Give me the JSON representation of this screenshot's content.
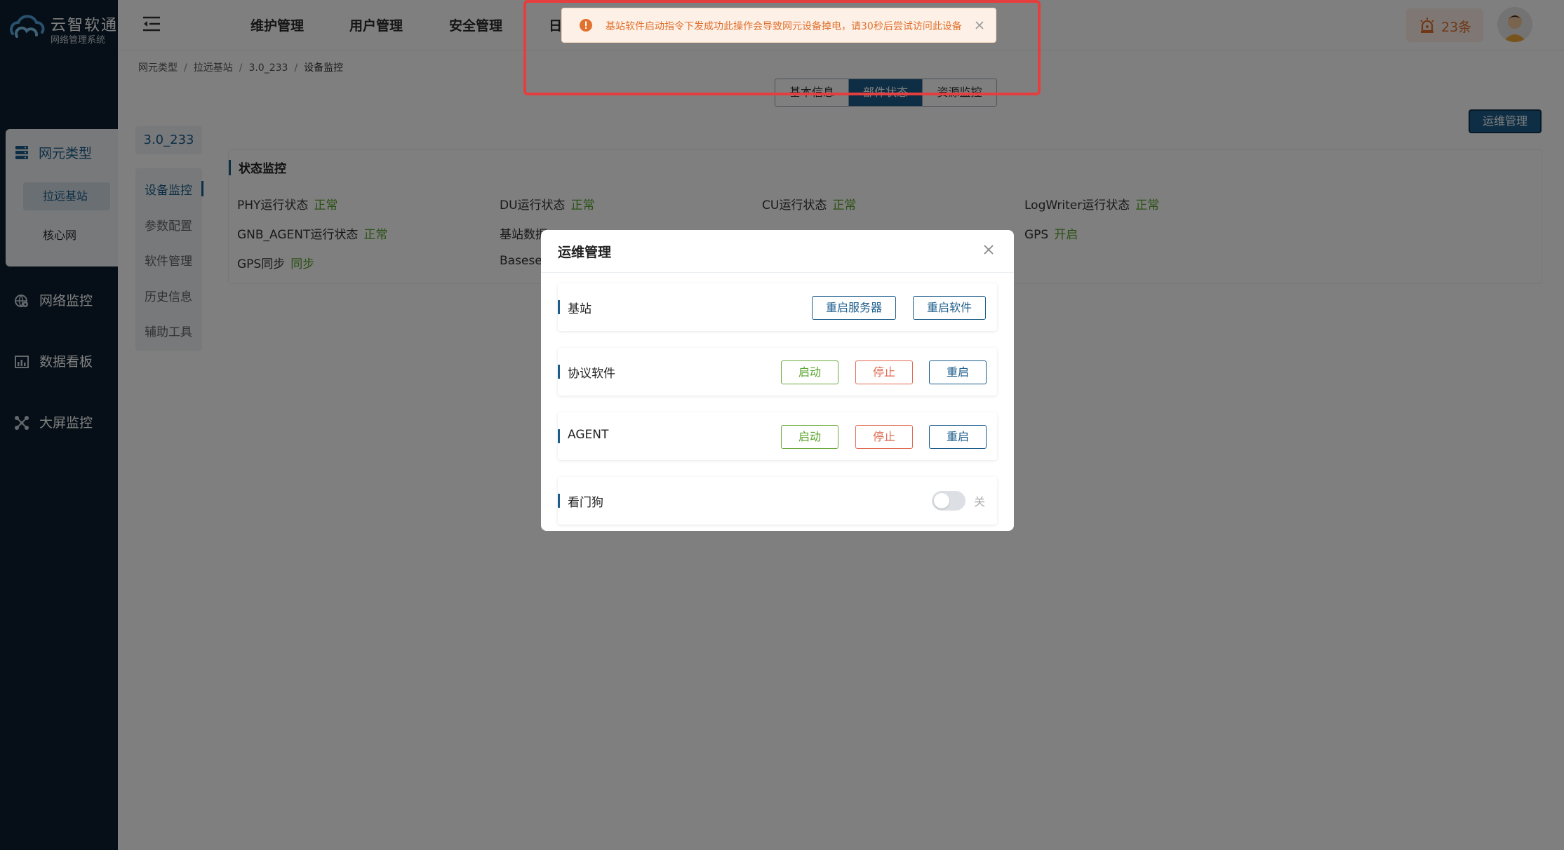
{
  "brand": {
    "title": "云智软通",
    "subtitle": "网络管理系统"
  },
  "sidebar": {
    "group": {
      "label": "网元类型",
      "items": [
        {
          "label": "拉远基站",
          "active": true
        },
        {
          "label": "核心网",
          "active": false
        }
      ]
    },
    "items": [
      {
        "label": "网络监控",
        "icon": "globe-gear-icon"
      },
      {
        "label": "数据看板",
        "icon": "bar-chart-icon"
      },
      {
        "label": "大屏监控",
        "icon": "network-icon"
      }
    ]
  },
  "header": {
    "nav": [
      "维护管理",
      "用户管理",
      "安全管理",
      "日"
    ],
    "alarm_count": "23条"
  },
  "breadcrumb": [
    "网元类型",
    "拉远基站",
    "3.0_233",
    "设备监控"
  ],
  "tabs": [
    {
      "label": "基本信息",
      "active": false
    },
    {
      "label": "部件状态",
      "active": true
    },
    {
      "label": "资源监控",
      "active": false
    }
  ],
  "ops_button": "运维管理",
  "device_name": "3.0_233",
  "side_menu": [
    {
      "label": "设备监控",
      "active": true
    },
    {
      "label": "参数配置",
      "active": false
    },
    {
      "label": "软件管理",
      "active": false
    },
    {
      "label": "历史信息",
      "active": false
    },
    {
      "label": "辅助工具",
      "active": false
    }
  ],
  "status_panel": {
    "title": "状态监控",
    "items": [
      {
        "label": "PHY运行状态",
        "value": "正常"
      },
      {
        "label": "DU运行状态",
        "value": "正常"
      },
      {
        "label": "CU运行状态",
        "value": "正常"
      },
      {
        "label": "LogWriter运行状态",
        "value": "正常"
      },
      {
        "label": "GNB_AGENT运行状态",
        "value": "正常"
      },
      {
        "label": "基站数据",
        "value": ""
      },
      {
        "label": "GPS",
        "value": "开启"
      },
      {
        "label": "GPS同步",
        "value": "同步"
      },
      {
        "label": "Basese",
        "value": ""
      }
    ]
  },
  "modal": {
    "title": "运维管理",
    "rows": [
      {
        "label": "基站",
        "buttons": [
          "重启服务器",
          "重启软件"
        ]
      },
      {
        "label": "协议软件",
        "buttons": [
          "启动",
          "停止",
          "重启"
        ]
      },
      {
        "label": "AGENT",
        "buttons": [
          "启动",
          "停止",
          "重启"
        ]
      },
      {
        "label": "看门狗",
        "toggle_label": "关",
        "toggle_on": false
      }
    ]
  },
  "toast": {
    "message": "基站软件启动指令下发成功此操作会导致网元设备掉电，请30秒后尝试访问此设备"
  },
  "colors": {
    "primary": "#1d5d8b",
    "sidebar_bg": "#0c1f2e",
    "success": "#57a32a",
    "danger": "#e06b52",
    "warning": "#e0712f",
    "highlight": "#e53e3e"
  }
}
